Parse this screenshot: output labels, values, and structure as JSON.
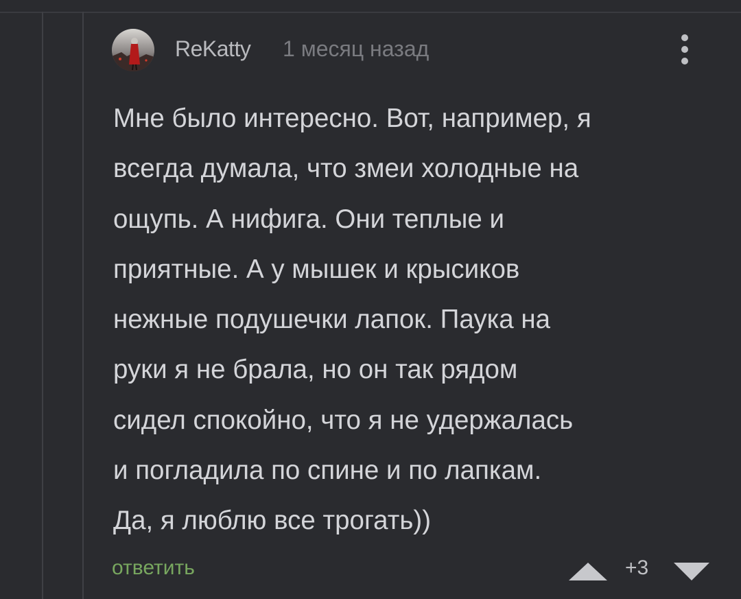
{
  "comment": {
    "author": "ReKatty",
    "time": "1 месяц назад",
    "body": "Мне было интересно. Вот, например, я\nвсегда думала, что змеи холодные на\nощупь. А нифига. Они теплые и\nприятные. А у мышек и крысиков\nнежные подушечки лапок. Паука на\nруки я не брала, но он так рядом\nсидел спокойно, что я не удержалась\nи погладила по спине и по лапкам.\nДа, я люблю все трогать))",
    "reply_label": "ответить",
    "rating": "+3"
  },
  "icons": {
    "menu": "more-vertical-icon",
    "upvote": "triangle-up-icon",
    "downvote": "triangle-down-icon"
  },
  "colors": {
    "background": "#2a2b2f",
    "text": "#d4d5d9",
    "muted": "#7a7b80",
    "reply": "#78a75f"
  }
}
